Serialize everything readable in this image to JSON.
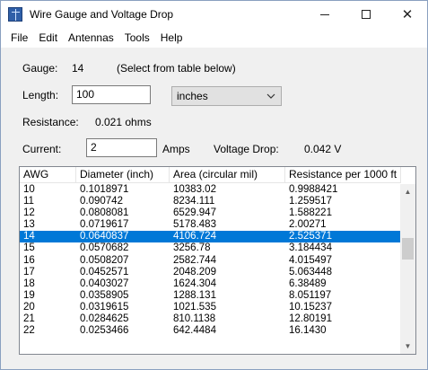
{
  "window": {
    "title": "Wire Gauge and Voltage Drop",
    "minimize_icon": "minimize-icon",
    "maximize_icon": "maximize-icon",
    "close_icon": "close-icon"
  },
  "menu": {
    "items": [
      {
        "label": "File"
      },
      {
        "label": "Edit"
      },
      {
        "label": "Antennas"
      },
      {
        "label": "Tools"
      },
      {
        "label": "Help"
      }
    ]
  },
  "form": {
    "gauge_label": "Gauge:",
    "gauge_value": "14",
    "gauge_hint": "(Select from table below)",
    "length_label": "Length:",
    "length_value": "100",
    "unit_selected": "inches",
    "resistance_label": "Resistance:",
    "resistance_value": "0.021 ohms",
    "current_label": "Current:",
    "current_value": "2",
    "current_unit": "Amps",
    "voltage_drop_label": "Voltage Drop:",
    "voltage_drop_value": "0.042 V"
  },
  "table": {
    "columns": [
      "AWG",
      "Diameter (inch)",
      "Area (circular mil)",
      "Resistance per 1000 ft"
    ],
    "selected_index": 4,
    "rows": [
      [
        "10",
        "0.1018971",
        "10383.02",
        "0.9988421"
      ],
      [
        "11",
        "0.090742",
        "8234.111",
        "1.259517"
      ],
      [
        "12",
        "0.0808081",
        "6529.947",
        "1.588221"
      ],
      [
        "13",
        "0.0719617",
        "5178.483",
        "2.00271"
      ],
      [
        "14",
        "0.0640837",
        "4106.724",
        "2.525371"
      ],
      [
        "15",
        "0.0570682",
        "3256.78",
        "3.184434"
      ],
      [
        "16",
        "0.0508207",
        "2582.744",
        "4.015497"
      ],
      [
        "17",
        "0.0452571",
        "2048.209",
        "5.063448"
      ],
      [
        "18",
        "0.0403027",
        "1624.304",
        "6.38489"
      ],
      [
        "19",
        "0.0358905",
        "1288.131",
        "8.051197"
      ],
      [
        "20",
        "0.0319615",
        "1021.535",
        "10.15237"
      ],
      [
        "21",
        "0.0284625",
        "810.1138",
        "12.80191"
      ],
      [
        "22",
        "0.0253466",
        "642.4484",
        "16.1430"
      ]
    ]
  },
  "icons": {
    "dropdown": "chevron-down-icon",
    "scroll_up": "scroll-up-icon",
    "scroll_down": "scroll-down-icon"
  }
}
